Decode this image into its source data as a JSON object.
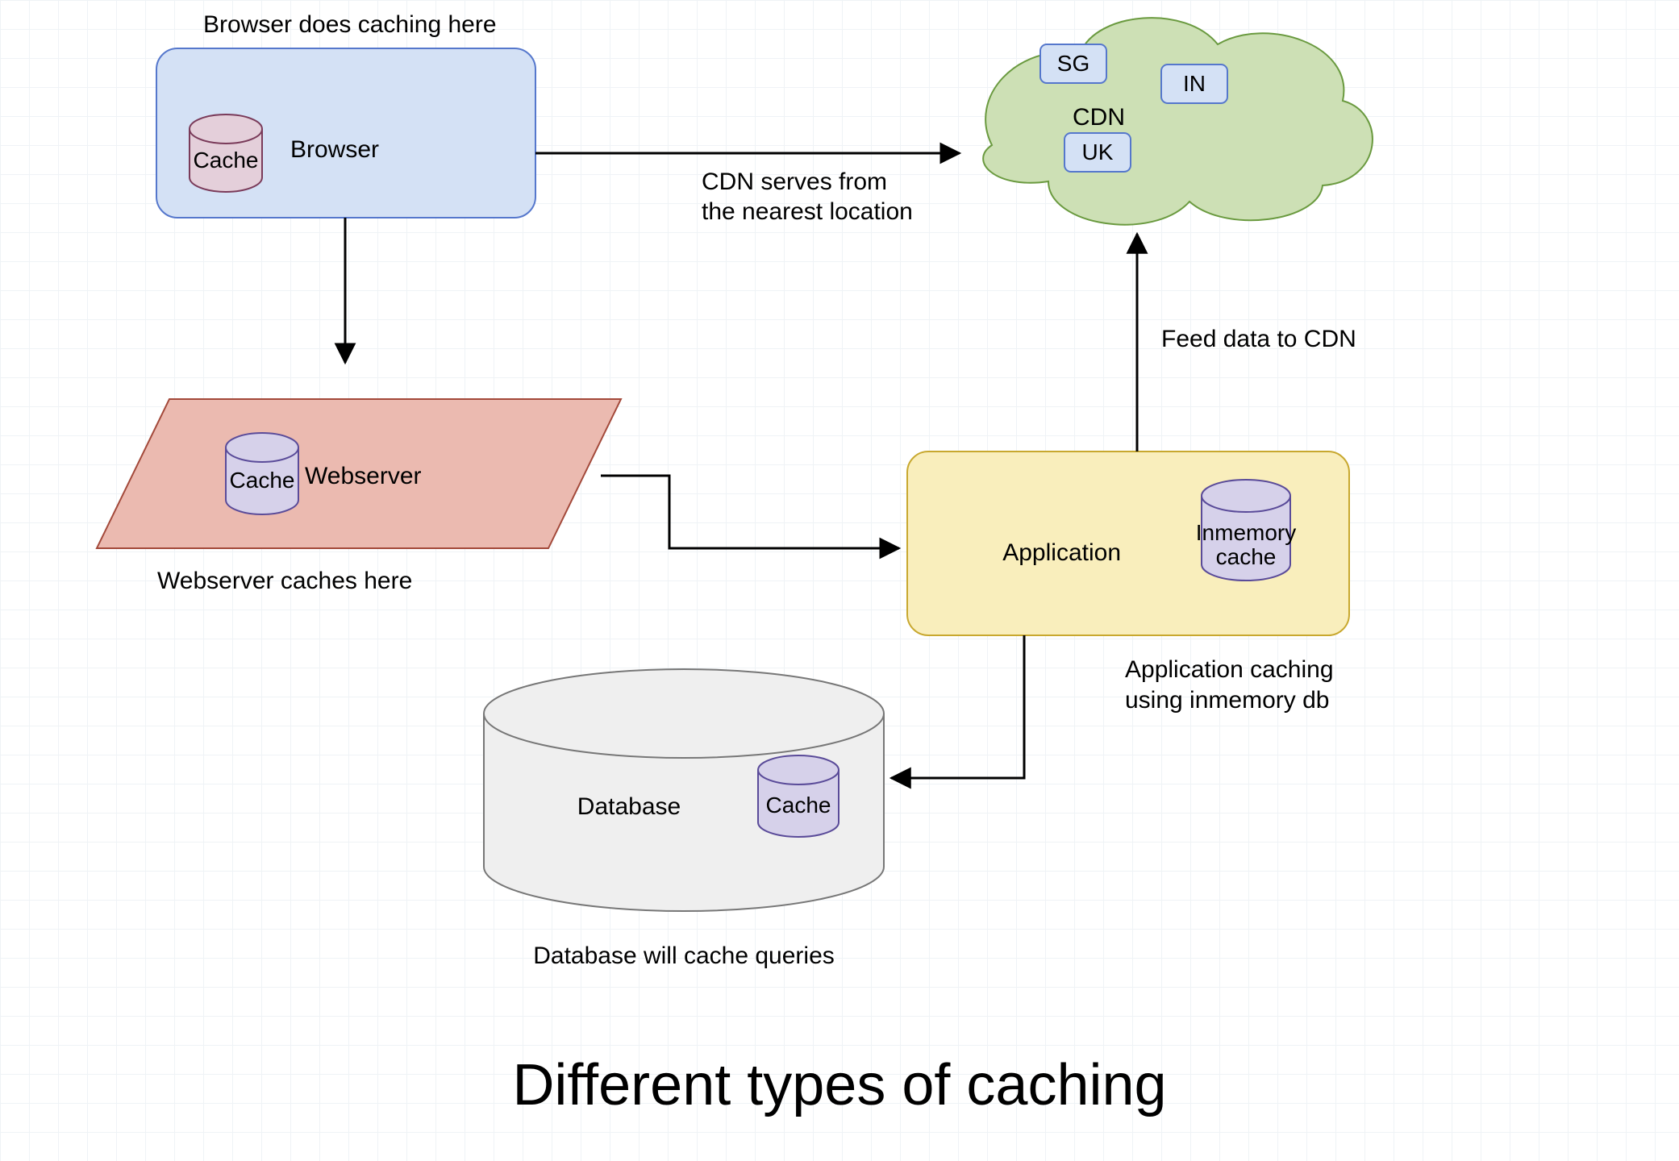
{
  "title": "Different types of caching",
  "browser": {
    "caption": "Browser does caching here",
    "label": "Browser",
    "cache": "Cache"
  },
  "cdn": {
    "label": "CDN",
    "regions": {
      "sg": "SG",
      "in": "IN",
      "uk": "UK"
    },
    "edge_label_line1": "CDN serves from",
    "edge_label_line2": "the nearest location",
    "feed_label": "Feed data to CDN"
  },
  "webserver": {
    "label": "Webserver",
    "cache": "Cache",
    "caption": "Webserver caches here"
  },
  "application": {
    "label": "Application",
    "cache_line1": "Inmemory",
    "cache_line2": "cache",
    "caption_line1": "Application caching",
    "caption_line2": "using inmemory db"
  },
  "database": {
    "label": "Database",
    "cache": "Cache",
    "caption": "Database will cache queries"
  }
}
